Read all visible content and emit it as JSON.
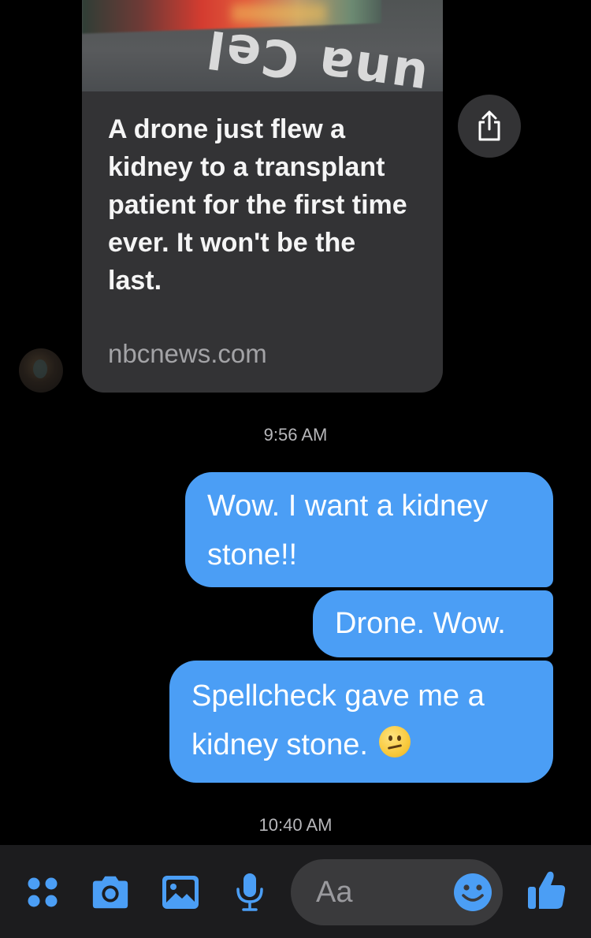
{
  "link_card": {
    "thumbnail_text": "una Cel",
    "title": "A drone just flew a kidney to a transplant patient for the first time ever. It won't be the last.",
    "domain": "nbcnews.com"
  },
  "timestamps": [
    "9:56 AM",
    "10:40 AM"
  ],
  "messages": [
    {
      "line1": "Wow. I want a kidney",
      "line2": "stone!!"
    },
    {
      "line1": "Drone. Wow."
    },
    {
      "line1": "Spellcheck gave me a",
      "line2": "kidney stone.",
      "emoji": "confused-face-emoji"
    }
  ],
  "composer": {
    "placeholder": "Aa",
    "icons": [
      "apps-icon",
      "camera-icon",
      "image-icon",
      "microphone-icon",
      "emoji-icon",
      "thumbs-up-icon"
    ]
  },
  "colors": {
    "background": "#000000",
    "outgoing_bubble": "#4b9ef5",
    "card": "#333335",
    "accent": "#4b9ef5",
    "timestamp": "#b7b7ba"
  }
}
